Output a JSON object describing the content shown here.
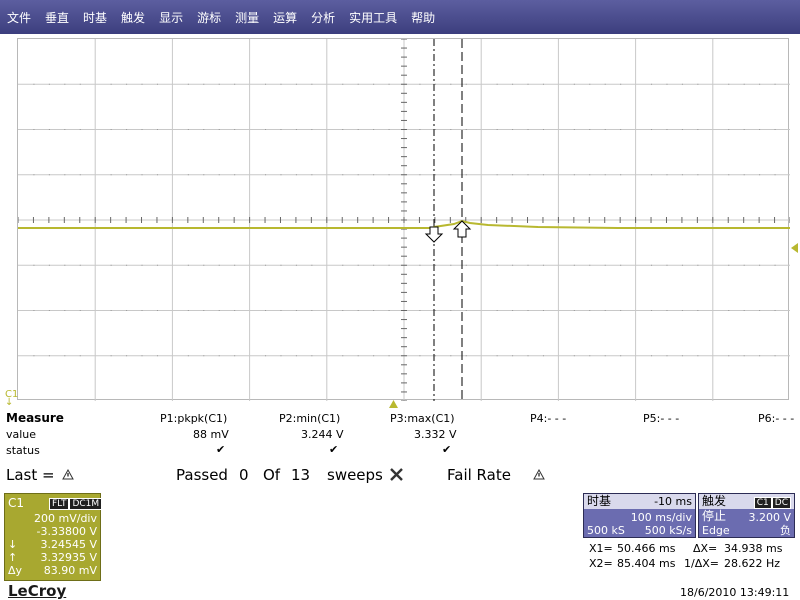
{
  "menu": [
    "文件",
    "垂直",
    "时基",
    "触发",
    "显示",
    "游标",
    "测量",
    "运算",
    "分析",
    "实用工具",
    "帮助"
  ],
  "channel_marker": "C1",
  "measure": {
    "title": "Measure",
    "row_value": "value",
    "row_status": "status",
    "params": [
      {
        "name": "P1:pkpk(C1)",
        "value": "88 mV"
      },
      {
        "name": "P2:min(C1)",
        "value": "3.244 V"
      },
      {
        "name": "P3:max(C1)",
        "value": "3.332 V"
      },
      {
        "name": "P4:- - -",
        "value": ""
      },
      {
        "name": "P5:- - -",
        "value": ""
      },
      {
        "name": "P6:- - -",
        "value": ""
      }
    ],
    "check_glyph": "✔"
  },
  "passfail": {
    "last_label": "Last =",
    "passed_label": "Passed",
    "passed_count": "0",
    "of_label": "Of",
    "total_count": "13",
    "sweeps_label": "sweeps",
    "fail_rate_label": "Fail Rate"
  },
  "channel_box": {
    "name": "C1",
    "tag1": "FLT",
    "tag2": "DC1M",
    "vdiv": "200 mV/div",
    "offset": "-3.33800 V",
    "cursor_down": "3.24545 V",
    "cursor_up": "3.32935 V",
    "delta_label": "Δy",
    "delta_value": "83.90 mV"
  },
  "timebase": {
    "title": "时基",
    "delay": "-10 ms",
    "tdiv": "100 ms/div",
    "samples": "500 kS",
    "rate": "500 kS/s"
  },
  "trigger": {
    "title": "触发",
    "source": "C1",
    "coupling": "DC",
    "mode": "停止",
    "level": "3.200 V",
    "type": "Edge",
    "slope": "负"
  },
  "cursors": {
    "x1_label": "X1=",
    "x1": "50.466 ms",
    "dx_label": "ΔX=",
    "dx": "34.938 ms",
    "x2_label": "X2=",
    "x2": "85.404 ms",
    "inv_dx_label": "1/ΔX=",
    "inv_dx": "28.622 Hz"
  },
  "brand": "LeCroy",
  "timestamp": "18/6/2010 13:49:11",
  "colors": {
    "trace": "#b8b830",
    "menu_bg": "#4a4c8c",
    "channel_box": "#a8a830",
    "info_box": "#6b6cb0"
  }
}
